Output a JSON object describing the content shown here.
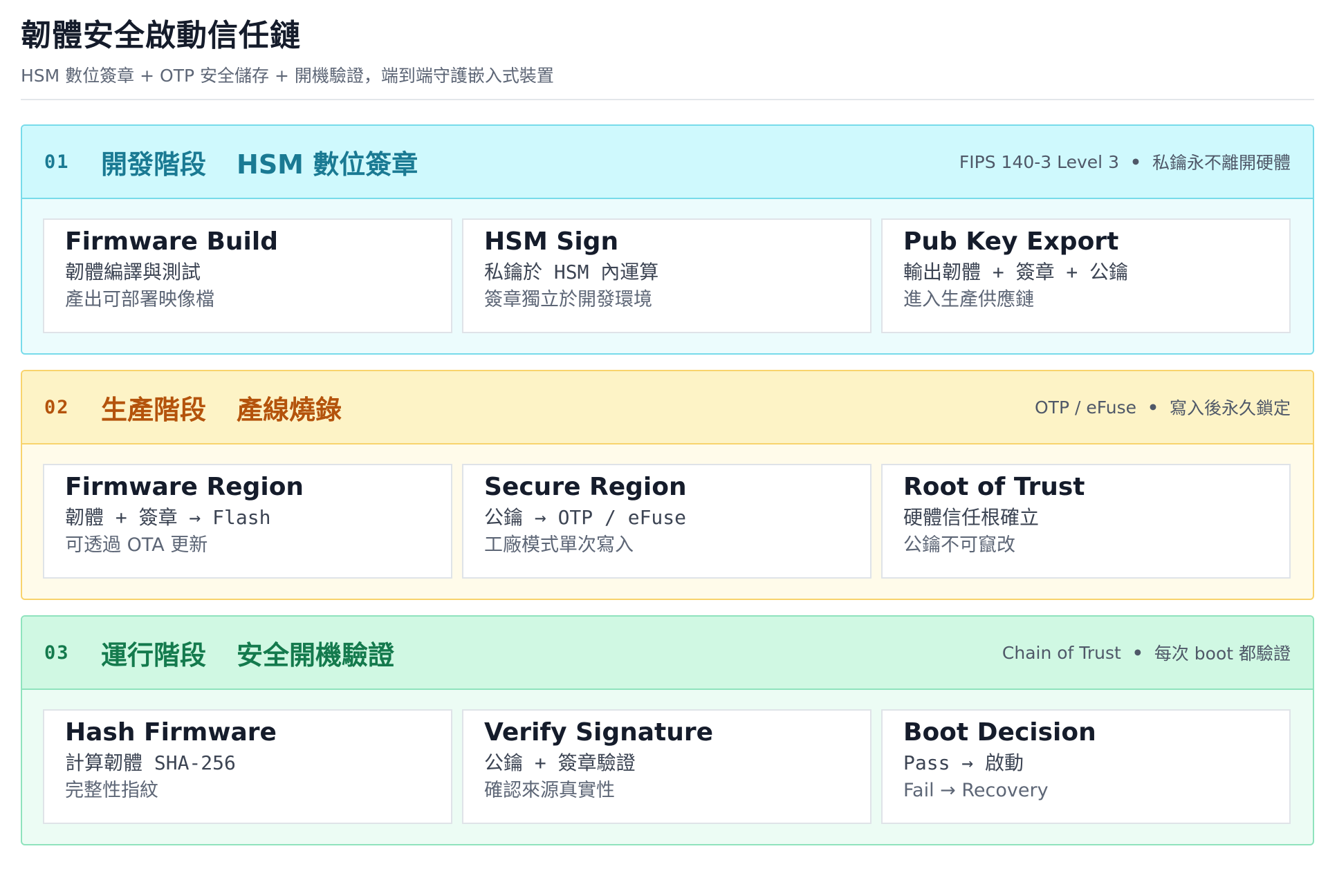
{
  "header": {
    "title": "韌體安全啟動信任鏈",
    "subtitle": "HSM 數位簽章 + OTP 安全儲存 + 開機驗證，端到端守護嵌入式裝置"
  },
  "stages": [
    {
      "number": "01",
      "name": "開發階段",
      "topic": "HSM 數位簽章",
      "note_a": "FIPS 140-3 Level 3",
      "note_sep": "•",
      "note_b": "私鑰永不離開硬體",
      "color": "#1a7a93",
      "cards": [
        {
          "title": "Firmware Build",
          "line1": "韌體編譯與測試",
          "line2": "產出可部署映像檔"
        },
        {
          "title": "HSM Sign",
          "line1": "私鑰於 HSM 內運算",
          "line2": "簽章獨立於開發環境"
        },
        {
          "title": "Pub Key Export",
          "line1": "輸出韌體 + 簽章 + 公鑰",
          "line2": "進入生產供應鏈"
        }
      ]
    },
    {
      "number": "02",
      "name": "生產階段",
      "topic": "產線燒錄",
      "note_a": "OTP / eFuse",
      "note_sep": "•",
      "note_b": "寫入後永久鎖定",
      "color": "#b4530c",
      "cards": [
        {
          "title": "Firmware Region",
          "line1": "韌體 + 簽章 → Flash",
          "line2": "可透過 OTA 更新"
        },
        {
          "title": "Secure Region",
          "line1": "公鑰 → OTP / eFuse",
          "line2": "工廠模式單次寫入"
        },
        {
          "title": "Root of Trust",
          "line1": "硬體信任根確立",
          "line2": "公鑰不可竄改"
        }
      ]
    },
    {
      "number": "03",
      "name": "運行階段",
      "topic": "安全開機驗證",
      "note_a": "Chain of Trust",
      "note_sep": "•",
      "note_b": "每次 boot 都驗證",
      "color": "#147a4d",
      "cards": [
        {
          "title": "Hash Firmware",
          "line1": "計算韌體 SHA-256",
          "line2": "完整性指紋"
        },
        {
          "title": "Verify Signature",
          "line1": "公鑰 + 簽章驗證",
          "line2": "確認來源真實性"
        },
        {
          "title": "Boot Decision",
          "line1": "Pass → 啟動",
          "line2": "Fail → Recovery"
        }
      ]
    }
  ]
}
